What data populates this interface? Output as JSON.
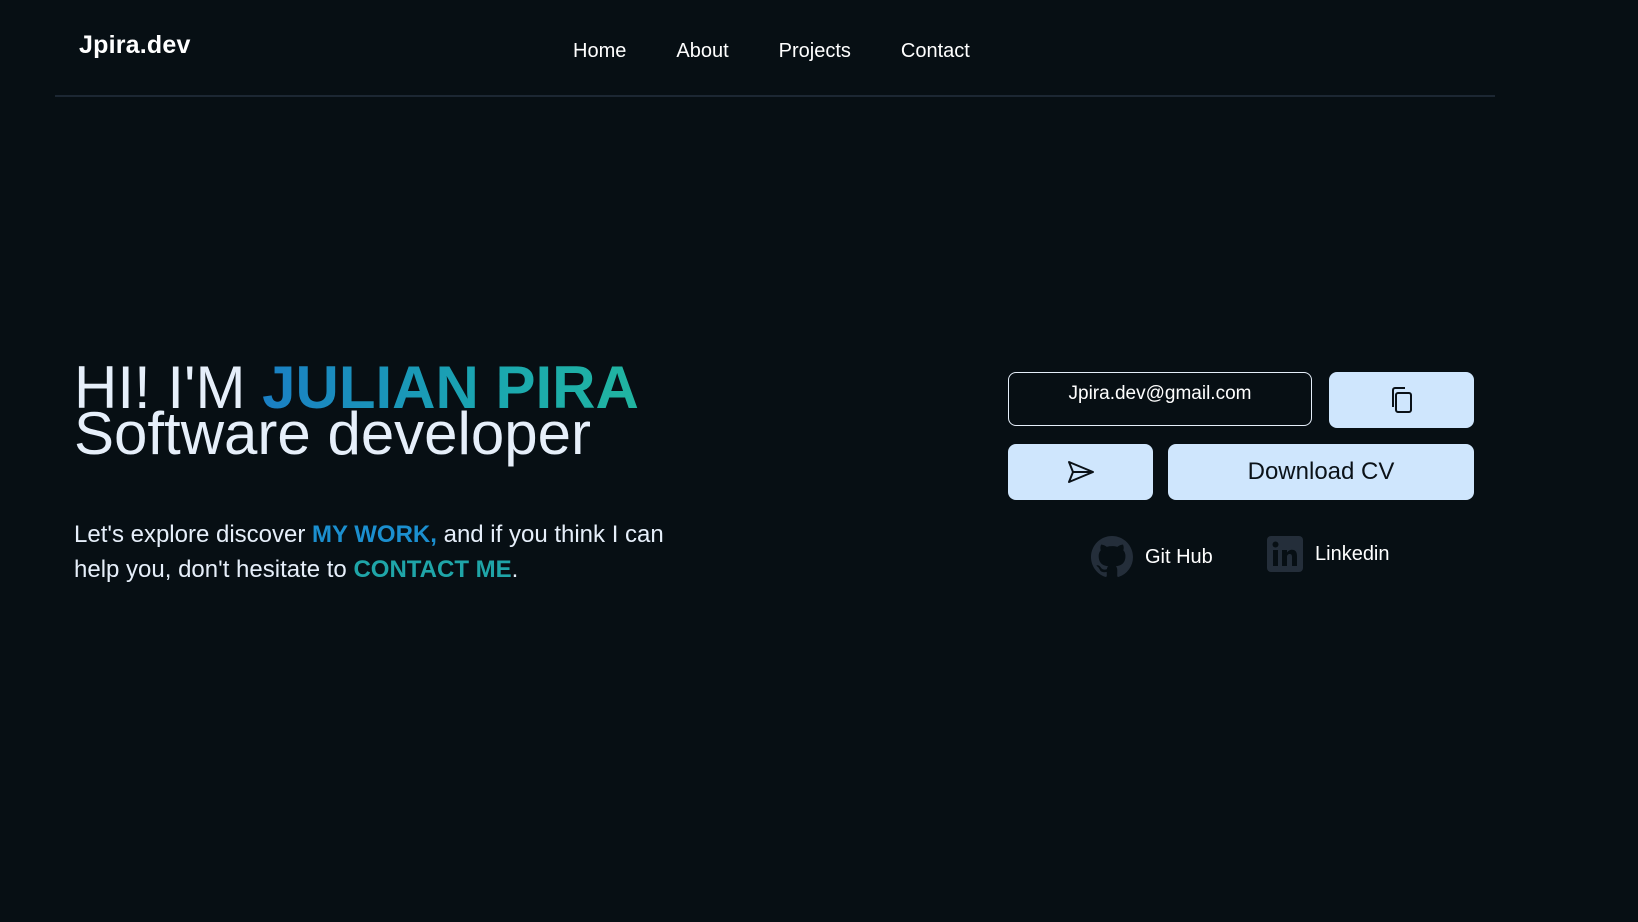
{
  "header": {
    "logo": "Jpira.dev",
    "nav": [
      {
        "label": "Home"
      },
      {
        "label": "About"
      },
      {
        "label": "Projects"
      },
      {
        "label": "Contact"
      }
    ]
  },
  "hero": {
    "greeting": "HI! I'M ",
    "name": "JULIAN PIRA",
    "subtitle": "Software developer",
    "desc_part1": "Let's explore discover ",
    "desc_highlight1": "MY WORK,",
    "desc_part2": " and if you think I can help you, don't hesitate to ",
    "desc_highlight2": "CONTACT ME",
    "desc_part3": "."
  },
  "contact": {
    "email": "Jpira.dev@gmail.com",
    "download_label": "Download CV",
    "copy_icon": "copy-icon",
    "send_icon": "send-icon"
  },
  "social": {
    "github_label": "Git Hub",
    "linkedin_label": "Linkedin"
  },
  "colors": {
    "background": "#070f14",
    "button_bg": "#cfe6fd",
    "accent_blue": "#1b8fcf",
    "accent_teal": "#1fa5a8"
  }
}
